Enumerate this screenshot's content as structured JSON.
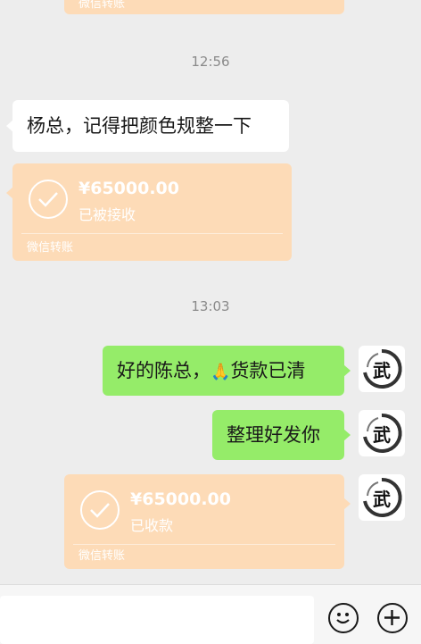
{
  "top_transfer": {
    "label": "微信转账"
  },
  "timestamps": [
    "12:56",
    "13:03"
  ],
  "messages": {
    "m1": "杨总，记得把颜色规整一下",
    "m2_before": "好的陈总，",
    "m2_emoji": "🙏",
    "m2_after": "货款已清",
    "m3": "整理好发你"
  },
  "transfers": [
    {
      "amount": "¥65000.00",
      "status": "已被接收",
      "label": "微信转账"
    },
    {
      "amount": "¥65000.00",
      "status": "已收款",
      "label": "微信转账"
    }
  ],
  "avatar": {
    "char": "武"
  },
  "colors": {
    "background": "#ededed",
    "bubble_green": "#95ec69",
    "bubble_white": "#ffffff",
    "transfer_bg": "#fddbb7"
  },
  "icons": {
    "emoji_button": "smiley-face-icon",
    "more_button": "plus-circle-icon"
  }
}
